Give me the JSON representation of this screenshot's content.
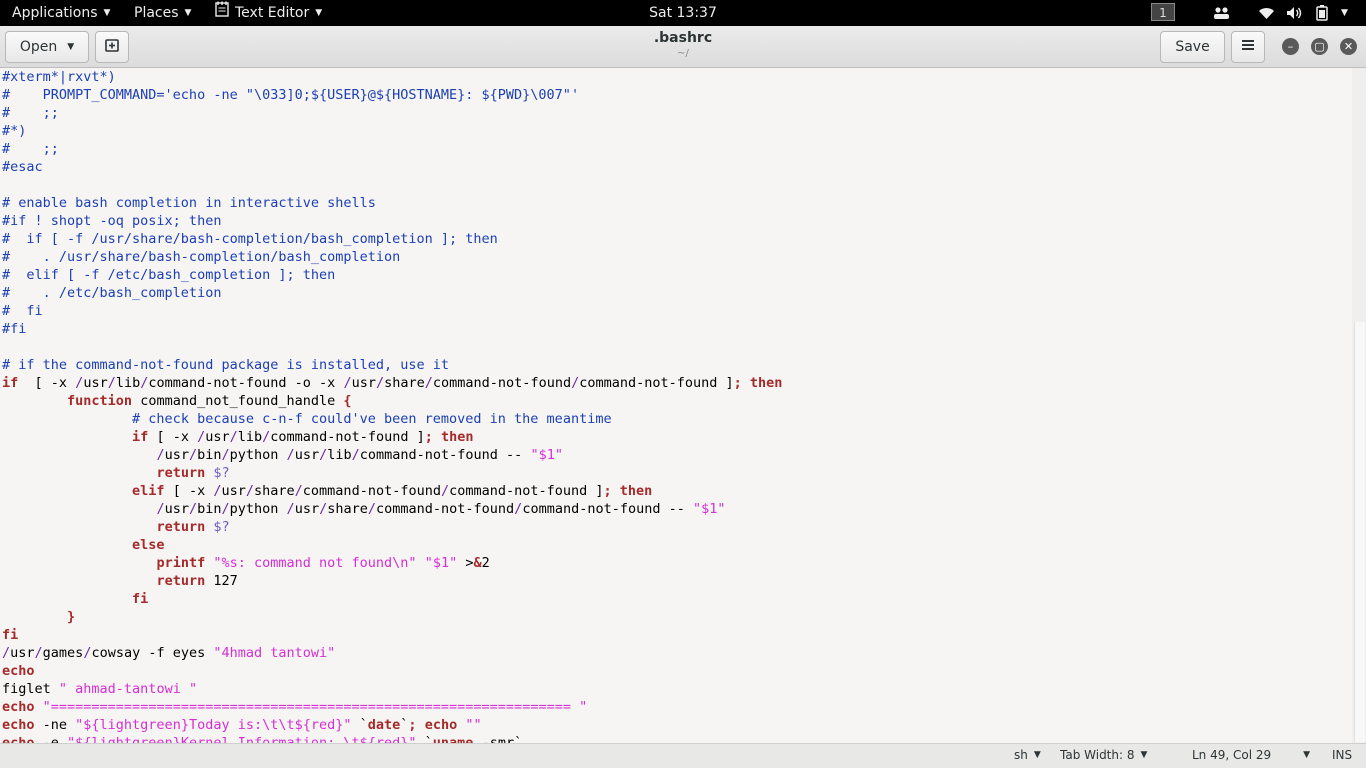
{
  "topbar": {
    "applications": "Applications",
    "places": "Places",
    "app_menu": "Text Editor",
    "clock": "Sat 13:37",
    "workspace": "1"
  },
  "header": {
    "open_label": "Open",
    "title": ".bashrc",
    "subtitle": "~/",
    "save_label": "Save"
  },
  "editor": {
    "lines": [
      [
        [
          "cm",
          "#xterm*|rxvt*)"
        ]
      ],
      [
        [
          "cm",
          "#    PROMPT_COMMAND='echo -ne \"\\033]0;${USER}@${HOSTNAME}: ${PWD}\\007\"'"
        ]
      ],
      [
        [
          "cm",
          "#    ;;"
        ]
      ],
      [
        [
          "cm",
          "#*)"
        ]
      ],
      [
        [
          "cm",
          "#    ;;"
        ]
      ],
      [
        [
          "cm",
          "#esac"
        ]
      ],
      [],
      [
        [
          "cm",
          "# enable bash completion in interactive shells"
        ]
      ],
      [
        [
          "cm",
          "#if ! shopt -oq posix; then"
        ]
      ],
      [
        [
          "cm",
          "#  if [ -f /usr/share/bash-completion/bash_completion ]; then"
        ]
      ],
      [
        [
          "cm",
          "#    . /usr/share/bash-completion/bash_completion"
        ]
      ],
      [
        [
          "cm",
          "#  elif [ -f /etc/bash_completion ]; then"
        ]
      ],
      [
        [
          "cm",
          "#    . /etc/bash_completion"
        ]
      ],
      [
        [
          "cm",
          "#  fi"
        ]
      ],
      [
        [
          "cm",
          "#fi"
        ]
      ],
      [],
      [
        [
          "cm",
          "# if the command-not-found package is installed, use it"
        ]
      ],
      [
        [
          "kw",
          "if"
        ],
        [
          "",
          "  [ -x "
        ],
        [
          "op",
          "/"
        ],
        [
          "",
          "usr"
        ],
        [
          "op",
          "/"
        ],
        [
          "",
          "lib"
        ],
        [
          "op",
          "/"
        ],
        [
          "",
          "command-not-found -o -x "
        ],
        [
          "op",
          "/"
        ],
        [
          "",
          "usr"
        ],
        [
          "op",
          "/"
        ],
        [
          "",
          "share"
        ],
        [
          "op",
          "/"
        ],
        [
          "",
          "command-not-found"
        ],
        [
          "op",
          "/"
        ],
        [
          "",
          "command-not-found ]"
        ],
        [
          "kw",
          "; then"
        ]
      ],
      [
        [
          "",
          "        "
        ],
        [
          "kw",
          "function"
        ],
        [
          "",
          " command_not_found_handle "
        ],
        [
          "kw",
          "{"
        ]
      ],
      [
        [
          "",
          "                "
        ],
        [
          "cm",
          "# check because c-n-f could've been removed in the meantime"
        ]
      ],
      [
        [
          "",
          "                "
        ],
        [
          "kw",
          "if"
        ],
        [
          "",
          " [ -x "
        ],
        [
          "op",
          "/"
        ],
        [
          "",
          "usr"
        ],
        [
          "op",
          "/"
        ],
        [
          "",
          "lib"
        ],
        [
          "op",
          "/"
        ],
        [
          "",
          "command-not-found ]"
        ],
        [
          "kw",
          "; then"
        ]
      ],
      [
        [
          "",
          "                   "
        ],
        [
          "op",
          "/"
        ],
        [
          "",
          "usr"
        ],
        [
          "op",
          "/"
        ],
        [
          "",
          "bin"
        ],
        [
          "op",
          "/"
        ],
        [
          "",
          "python "
        ],
        [
          "op",
          "/"
        ],
        [
          "",
          "usr"
        ],
        [
          "op",
          "/"
        ],
        [
          "",
          "lib"
        ],
        [
          "op",
          "/"
        ],
        [
          "",
          "command-not-found -- "
        ],
        [
          "str",
          "\"$1\""
        ]
      ],
      [
        [
          "",
          "                   "
        ],
        [
          "kw",
          "return"
        ],
        [
          "",
          " "
        ],
        [
          "var",
          "$?"
        ]
      ],
      [
        [
          "",
          "                "
        ],
        [
          "kw",
          "elif"
        ],
        [
          "",
          " [ -x "
        ],
        [
          "op",
          "/"
        ],
        [
          "",
          "usr"
        ],
        [
          "op",
          "/"
        ],
        [
          "",
          "share"
        ],
        [
          "op",
          "/"
        ],
        [
          "",
          "command-not-found"
        ],
        [
          "op",
          "/"
        ],
        [
          "",
          "command-not-found ]"
        ],
        [
          "kw",
          "; then"
        ]
      ],
      [
        [
          "",
          "                   "
        ],
        [
          "op",
          "/"
        ],
        [
          "",
          "usr"
        ],
        [
          "op",
          "/"
        ],
        [
          "",
          "bin"
        ],
        [
          "op",
          "/"
        ],
        [
          "",
          "python "
        ],
        [
          "op",
          "/"
        ],
        [
          "",
          "usr"
        ],
        [
          "op",
          "/"
        ],
        [
          "",
          "share"
        ],
        [
          "op",
          "/"
        ],
        [
          "",
          "command-not-found"
        ],
        [
          "op",
          "/"
        ],
        [
          "",
          "command-not-found -- "
        ],
        [
          "str",
          "\"$1\""
        ]
      ],
      [
        [
          "",
          "                   "
        ],
        [
          "kw",
          "return"
        ],
        [
          "",
          " "
        ],
        [
          "var",
          "$?"
        ]
      ],
      [
        [
          "",
          "                "
        ],
        [
          "kw",
          "else"
        ]
      ],
      [
        [
          "",
          "                   "
        ],
        [
          "kw",
          "printf"
        ],
        [
          "",
          " "
        ],
        [
          "str",
          "\"%s: command not found\\n\""
        ],
        [
          "",
          " "
        ],
        [
          "str",
          "\"$1\""
        ],
        [
          "",
          " >"
        ],
        [
          "kw",
          "&"
        ],
        [
          "",
          "2"
        ]
      ],
      [
        [
          "",
          "                   "
        ],
        [
          "kw",
          "return"
        ],
        [
          "",
          " 127"
        ]
      ],
      [
        [
          "",
          "                "
        ],
        [
          "kw",
          "fi"
        ]
      ],
      [
        [
          "",
          "        "
        ],
        [
          "kw",
          "}"
        ]
      ],
      [
        [
          "kw",
          "fi"
        ]
      ],
      [
        [
          "op",
          "/"
        ],
        [
          "",
          "usr"
        ],
        [
          "op",
          "/"
        ],
        [
          "",
          "games"
        ],
        [
          "op",
          "/"
        ],
        [
          "",
          "cowsay -f eyes "
        ],
        [
          "str",
          "\"4hmad tantowi\""
        ]
      ],
      [
        [
          "kw",
          "echo"
        ]
      ],
      [
        [
          "",
          "figlet "
        ],
        [
          "str",
          "\" ahmad-tantowi \""
        ]
      ],
      [
        [
          "kw",
          "echo"
        ],
        [
          "",
          " "
        ],
        [
          "str",
          "\"================================================================ \""
        ]
      ],
      [
        [
          "kw",
          "echo"
        ],
        [
          "",
          " -ne "
        ],
        [
          "str",
          "\"${lightgreen}Today is:\\t\\t${red}\""
        ],
        [
          "",
          " `"
        ],
        [
          "kw",
          "date"
        ],
        [
          "",
          "`"
        ],
        [
          "kw",
          ";"
        ],
        [
          "",
          " "
        ],
        [
          "kw",
          "echo"
        ],
        [
          "",
          " "
        ],
        [
          "str",
          "\"\""
        ]
      ],
      [
        [
          "kw",
          "echo"
        ],
        [
          "",
          " -e "
        ],
        [
          "str",
          "\"${lightgreen}Kernel Information: \\t${red}\""
        ],
        [
          "",
          " `"
        ],
        [
          "kw",
          "uname"
        ],
        [
          "",
          " -smr`"
        ]
      ]
    ]
  },
  "statusbar": {
    "language": "sh",
    "tab_width": "Tab Width: 8",
    "position": "Ln 49, Col 29",
    "mode": "INS"
  }
}
